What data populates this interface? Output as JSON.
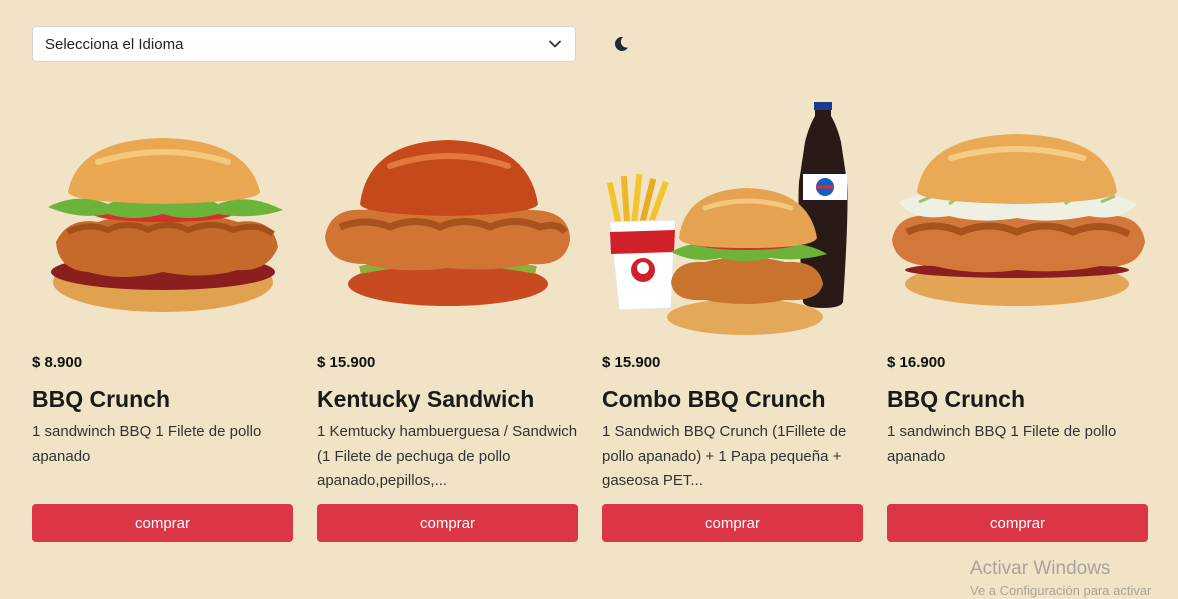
{
  "language_select": {
    "placeholder": "Selecciona el Idioma"
  },
  "theme_toggle": {
    "icon": "moon-icon"
  },
  "colors": {
    "background": "#f1e3c5",
    "button": "#dc3545",
    "button_text": "#ffffff"
  },
  "products": [
    {
      "price": "$ 8.900",
      "title": "BBQ Crunch",
      "description": "1 sandwinch BBQ 1 Filete de pollo apanado",
      "button": "comprar",
      "image": "bbq-crunch-burger-image"
    },
    {
      "price": "$ 15.900",
      "title": "Kentucky Sandwich",
      "description": "1 Kemtucky hambuerguesa / Sandwich (1 Filete de pechuga de pollo apanado,pepillos,...",
      "button": "comprar",
      "image": "kentucky-sandwich-image"
    },
    {
      "price": "$ 15.900",
      "title": "Combo BBQ Crunch",
      "description": "1 Sandwich BBQ Crunch (1Fillete de pollo apanado) + 1 Papa pequeña + gaseosa PET...",
      "button": "comprar",
      "image": "combo-bbq-crunch-image"
    },
    {
      "price": "$ 16.900",
      "title": "BBQ Crunch",
      "description": "1 sandwinch BBQ 1 Filete de pollo apanado",
      "button": "comprar",
      "image": "coleslaw-chicken-burger-image"
    }
  ],
  "watermark": {
    "line1": "Activar Windows",
    "line2": "Ve a Configuración para activar"
  }
}
